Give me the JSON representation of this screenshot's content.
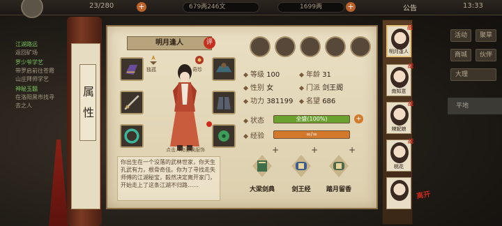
{
  "topbar": {
    "stamina": "23/280",
    "silver": "679两246文",
    "gold": "1699两",
    "announcement": "公告",
    "time": "13:33"
  },
  "quest_log": [
    {
      "title": "江湖路远",
      "lines": [
        "返回矿场"
      ]
    },
    {
      "title": "罗少爷学艺",
      "lines": [
        "带罗启前往苍霞",
        "山庄拜师学艺"
      ]
    },
    {
      "title": "神秘玉髓",
      "lines": [
        "在洛阳黑市找寻",
        "去之人"
      ]
    }
  ],
  "right_menu": {
    "buttons": [
      "活动",
      "聚草",
      "商城",
      "伙伴",
      "大理",
      "平地"
    ],
    "map_label": "平地"
  },
  "scroll_seal": "属性",
  "character": {
    "name": "明月逢人",
    "eval_label": "评",
    "caption": "点击人物更换服饰",
    "mini_labels": [
      "独孤",
      "奇珍"
    ],
    "description": "你出生在一个没落的武林世家，你天生孔武有力，根骨奇佳。你为了寻找走失师傅的江湖秘宝，毅然决定离开家门，开始走上了这条江湖不归路……"
  },
  "stats": {
    "level_label": "等级",
    "level": "100",
    "age_label": "年龄",
    "age": "31",
    "gender_label": "性别",
    "gender": "女",
    "sect_label": "门派",
    "sect": "剑王阁",
    "power_label": "功力",
    "power": "381199",
    "fame_label": "名望",
    "fame": "686",
    "status_label": "状态",
    "status_text": "全盛(100%)",
    "status_percent": 100,
    "exp_label": "经验",
    "exp_text": "∞/∞",
    "exp_percent": 100
  },
  "martial_arts": [
    {
      "name": "大梁剑典"
    },
    {
      "name": "剑王经"
    },
    {
      "name": "踏月留香"
    }
  ],
  "roster": [
    {
      "name": "明月逢人",
      "tag": "战"
    },
    {
      "name": "南知意",
      "tag": "战"
    },
    {
      "name": "辣妮娘",
      "tag": "战"
    },
    {
      "name": "桃花",
      "tag": "战"
    },
    {
      "name": "",
      "tag": ""
    }
  ],
  "leave_label": "离开",
  "colors": {
    "status_fill": "#6aa12f",
    "exp_fill": "#d4782c",
    "accent_red": "#c42a1c"
  }
}
